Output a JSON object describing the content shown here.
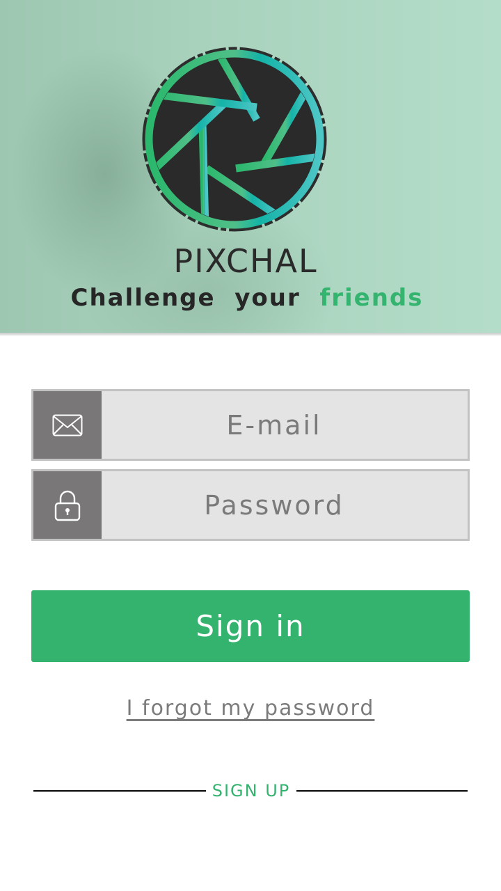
{
  "brand": {
    "app_name": "PIXCHAL",
    "tagline_part1": "Challenge  your  ",
    "tagline_accent": "friends",
    "accent_color": "#34b36f"
  },
  "form": {
    "email": {
      "placeholder": "E-mail",
      "value": "",
      "icon": "envelope-icon"
    },
    "password": {
      "placeholder": "Password",
      "value": "",
      "icon": "padlock-icon"
    },
    "signin_label": "Sign in",
    "forgot_label": "I forgot my password",
    "signup_label": "SIGN UP"
  }
}
